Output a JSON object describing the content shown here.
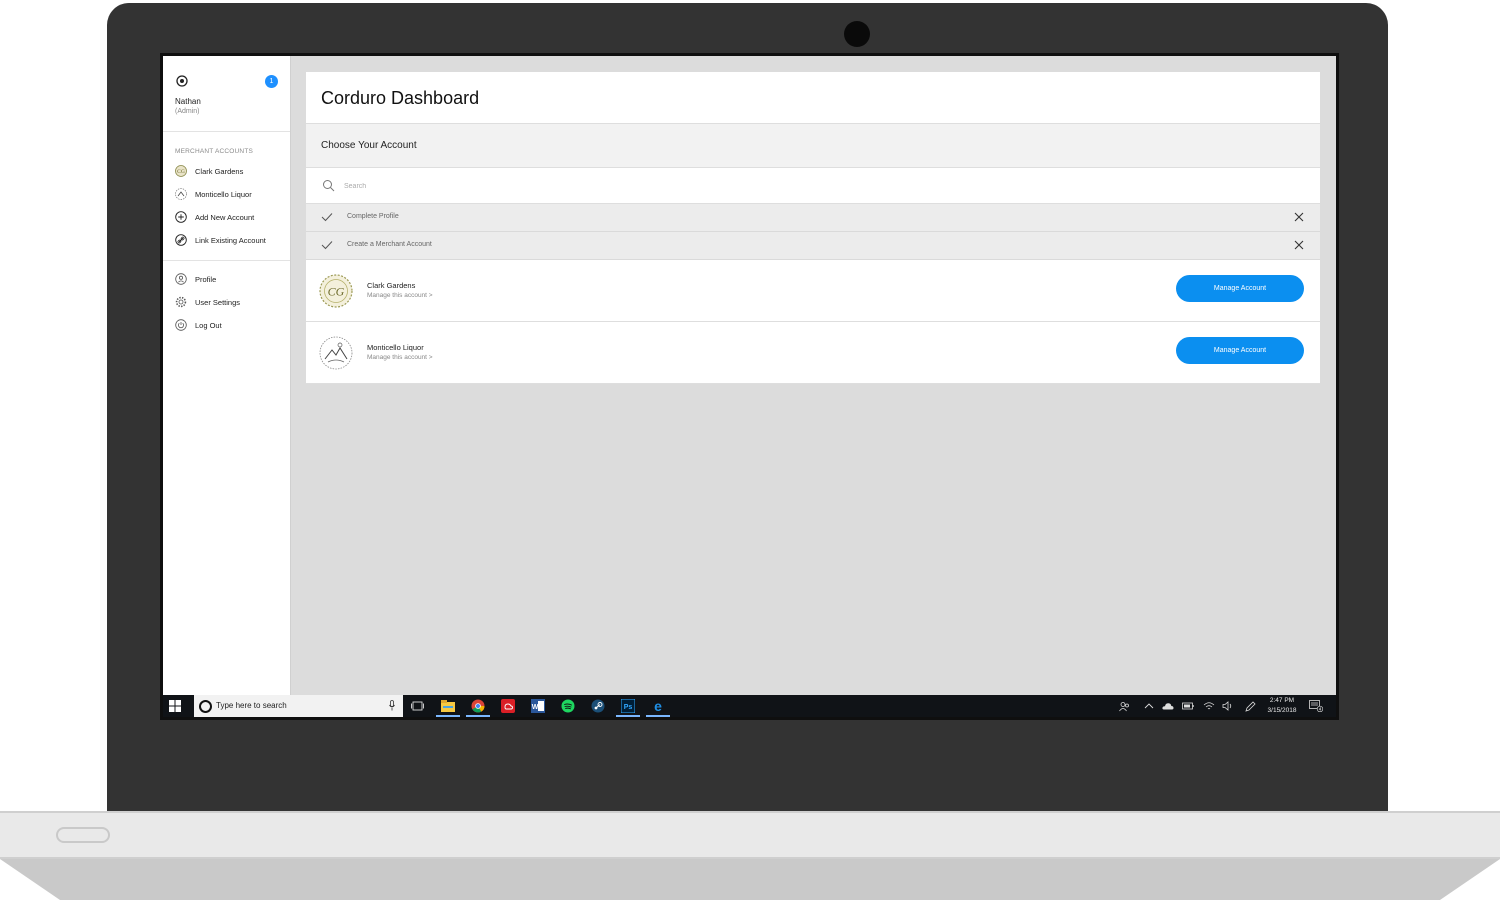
{
  "sidebar": {
    "user_name": "Nathan",
    "user_role": "(Admin)",
    "notification_count": "1",
    "section_label": "MERCHANT ACCOUNTS",
    "merchant_items": [
      {
        "label": "Clark Gardens",
        "icon": "clark-gardens-logo"
      },
      {
        "label": "Monticello Liquor",
        "icon": "monticello-liquor-logo"
      },
      {
        "label": "Add New Account",
        "icon": "plus-circle-icon"
      },
      {
        "label": "Link Existing Account",
        "icon": "link-icon"
      }
    ],
    "user_items": [
      {
        "label": "Profile",
        "icon": "profile-icon"
      },
      {
        "label": "User Settings",
        "icon": "gear-icon"
      },
      {
        "label": "Log Out",
        "icon": "power-icon"
      }
    ]
  },
  "main": {
    "title": "Corduro Dashboard",
    "choose_label": "Choose Your Account",
    "search_placeholder": "Search",
    "tasks": [
      {
        "label": "Complete Profile"
      },
      {
        "label": "Create a Merchant Account"
      }
    ],
    "accounts": [
      {
        "name": "Clark Gardens",
        "sub": "Manage this account >",
        "button": "Manage Account"
      },
      {
        "name": "Monticello Liquor",
        "sub": "Manage this account >",
        "button": "Manage Account"
      }
    ]
  },
  "taskbar": {
    "search_text": "Type here to search",
    "time": "2:47 PM",
    "date": "3/15/2018",
    "notification_count": "4"
  },
  "colors": {
    "accent": "#0b8ff0",
    "notification": "#1e90ff",
    "bezel": "#333333",
    "content_bg": "#dcdcdc",
    "taskbar": "#101317"
  }
}
